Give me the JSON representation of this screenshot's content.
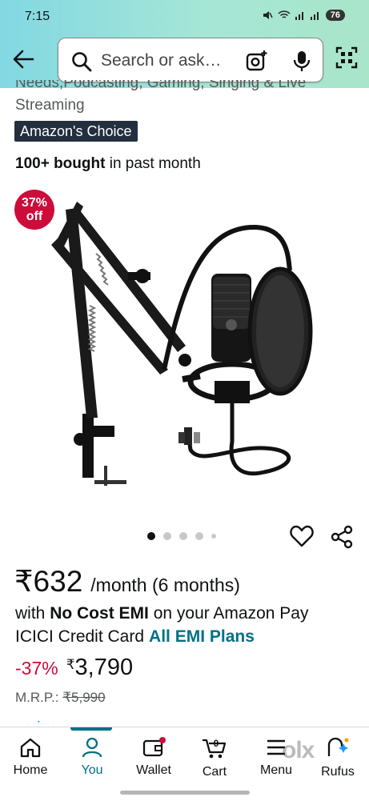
{
  "status_bar": {
    "time": "7:15",
    "battery": "76"
  },
  "search": {
    "placeholder": "Search or ask…"
  },
  "product": {
    "title_fragment": "Needs,Podcasting, Gaming, Singing & Live",
    "title_end": "Streaming",
    "badge": "Amazon's Choice",
    "bought_bold": "100+ bought",
    "bought_rest": " in past month",
    "discount_badge_pct": "37%",
    "discount_badge_off": "off",
    "image_dots": {
      "count": 5,
      "active_index": 0
    }
  },
  "pricing": {
    "emi_price": "₹632",
    "emi_unit": "/month (6 months)",
    "emi_line1_prefix": "with ",
    "emi_line1_bold": "No Cost EMI",
    "emi_line1_suffix": " on your Amazon Pay",
    "emi_line2": "ICICI Credit Card",
    "emi_link": "All EMI Plans",
    "discount_pct": "-37%",
    "currency": "₹",
    "price": "3,790",
    "mrp_label": "M.R.P.: ",
    "mrp": "₹5,990",
    "prime_text": "prime"
  },
  "bottom_nav": [
    {
      "label": "Home",
      "icon": "home-icon",
      "active": false
    },
    {
      "label": "You",
      "icon": "user-icon",
      "active": true
    },
    {
      "label": "Wallet",
      "icon": "wallet-icon",
      "active": false
    },
    {
      "label": "Cart",
      "icon": "cart-icon",
      "active": false,
      "count": "0"
    },
    {
      "label": "Menu",
      "icon": "menu-icon",
      "active": false
    },
    {
      "label": "Rufus",
      "icon": "rufus-icon",
      "active": false
    }
  ],
  "watermark": "olx",
  "colors": {
    "header_start": "#82d8e3",
    "header_end": "#a9e5c9",
    "accent_teal": "#007185",
    "deal_red": "#cc0c39",
    "badge_dark": "#232f3e"
  }
}
